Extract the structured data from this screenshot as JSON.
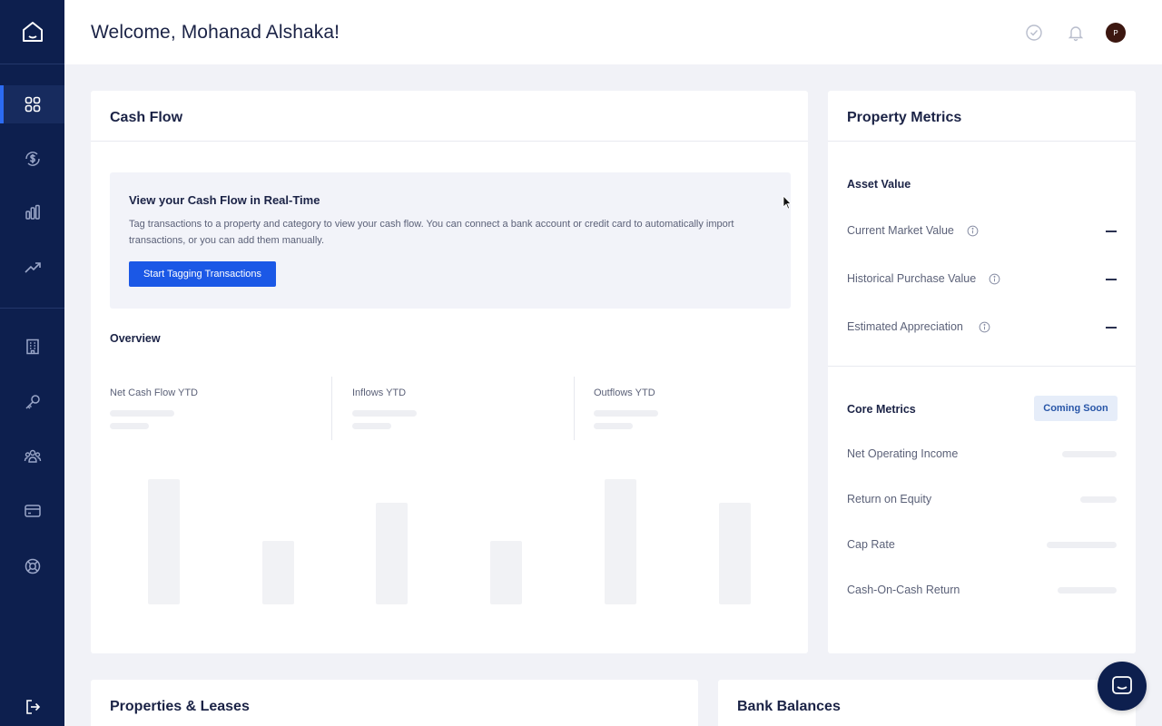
{
  "header": {
    "welcome": "Welcome, Mohanad Alshaka!",
    "avatar_initial": "P"
  },
  "sidebar": {
    "items": [
      {
        "icon": "dashboard-grid-icon",
        "active": true
      },
      {
        "icon": "dollar-cycle-icon"
      },
      {
        "icon": "bar-chart-icon"
      },
      {
        "icon": "trend-up-icon"
      },
      {
        "icon": "building-icon"
      },
      {
        "icon": "key-icon"
      },
      {
        "icon": "people-icon"
      },
      {
        "icon": "credit-card-icon"
      },
      {
        "icon": "lifebuoy-icon"
      },
      {
        "icon": "logout-icon"
      }
    ]
  },
  "cash_flow": {
    "title": "Cash Flow",
    "promo_title": "View your Cash Flow in Real-Time",
    "promo_text": "Tag transactions to a property and category to view your cash flow. You can connect a bank account or credit card to automatically import transactions, or you can add them manually.",
    "promo_button": "Start Tagging Transactions",
    "overview_title": "Overview",
    "stats": [
      {
        "label": "Net Cash Flow YTD"
      },
      {
        "label": "Inflows YTD"
      },
      {
        "label": "Outflows YTD"
      }
    ]
  },
  "property_metrics": {
    "title": "Property Metrics",
    "asset_value_title": "Asset Value",
    "asset_rows": [
      {
        "label": "Current Market Value",
        "value": "—"
      },
      {
        "label": "Historical Purchase Value",
        "value": "—"
      },
      {
        "label": "Estimated Appreciation",
        "value": "—"
      }
    ],
    "core_metrics_title": "Core Metrics",
    "core_badge": "Coming Soon",
    "core_rows": [
      {
        "label": "Net Operating Income"
      },
      {
        "label": "Return on Equity"
      },
      {
        "label": "Cap Rate"
      },
      {
        "label": "Cash-On-Cash Return"
      }
    ]
  },
  "properties_leases": {
    "title": "Properties & Leases"
  },
  "bank_balances": {
    "title": "Bank Balances"
  },
  "colors": {
    "sidebar": "#0d1f4e",
    "accent": "#1b58e6",
    "background": "#f1f2f7"
  }
}
